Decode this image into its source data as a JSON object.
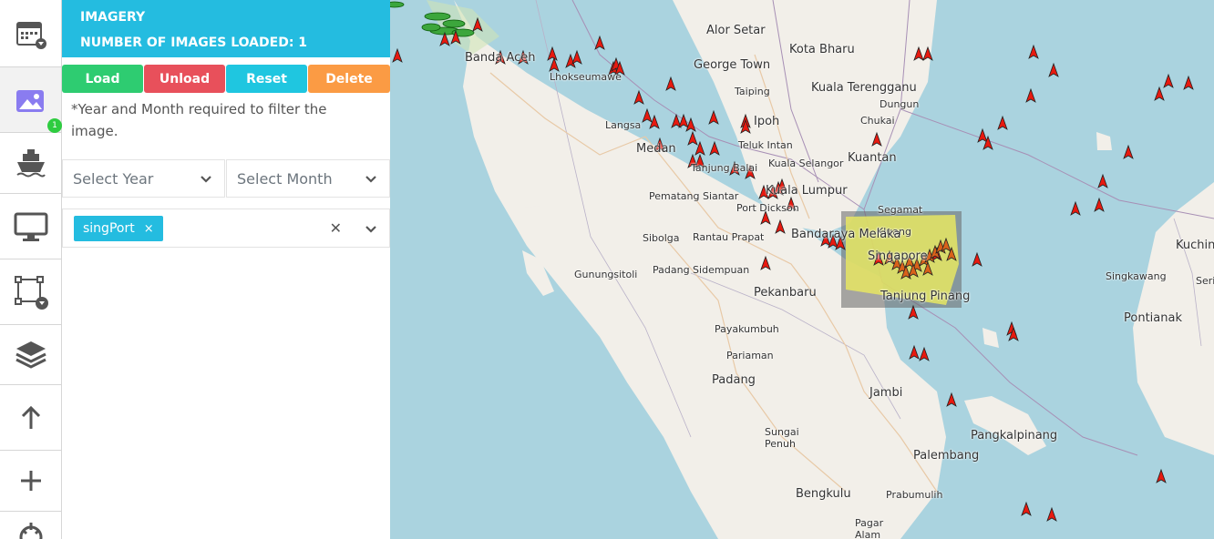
{
  "panel": {
    "title": "IMAGERY",
    "images_loaded": "NUMBER OF IMAGES LOADED: 1",
    "buttons": {
      "load": "Load",
      "unload": "Unload",
      "reset": "Reset",
      "delete": "Delete"
    },
    "note": "*Year and Month required to filter the image.",
    "year_placeholder": "Select Year",
    "month_placeholder": "Select Month",
    "tag": "singPort",
    "tag_remove": "×",
    "clear": "✕"
  },
  "rail": {
    "badge": "1"
  },
  "colors": {
    "header": "#24bce0",
    "load": "#2ecc71",
    "unload": "#e8505b",
    "reset": "#1fc6e0",
    "delete": "#fb9b44",
    "vessel": "#e8190f",
    "image_overlay": "#e6e663"
  },
  "map": {
    "places": [
      {
        "name": "Banda Aceh",
        "cls": "big"
      },
      {
        "name": "Lhokseumawe",
        "cls": "sm"
      },
      {
        "name": "Alor Setar",
        "cls": "big"
      },
      {
        "name": "Kota Bharu",
        "cls": "big"
      },
      {
        "name": "George Town",
        "cls": "big"
      },
      {
        "name": "Kuala Terengganu",
        "cls": "big"
      },
      {
        "name": "Taiping",
        "cls": "sm"
      },
      {
        "name": "Dungun",
        "cls": "sm"
      },
      {
        "name": "Ipoh",
        "cls": "big"
      },
      {
        "name": "Chukai",
        "cls": "sm"
      },
      {
        "name": "Langsa",
        "cls": "sm"
      },
      {
        "name": "Medan",
        "cls": "big"
      },
      {
        "name": "Teluk Intan",
        "cls": "sm"
      },
      {
        "name": "Kuantan",
        "cls": "big"
      },
      {
        "name": "Tanjung Balai",
        "cls": "sm"
      },
      {
        "name": "Kuala Selangor",
        "cls": "sm"
      },
      {
        "name": "Kuala Lumpur",
        "cls": "big"
      },
      {
        "name": "Pematang Siantar",
        "cls": "sm"
      },
      {
        "name": "Port Dickson",
        "cls": "sm"
      },
      {
        "name": "Segamat",
        "cls": "sm"
      },
      {
        "name": "Kluang",
        "cls": "sm"
      },
      {
        "name": "Sibolga",
        "cls": "sm"
      },
      {
        "name": "Rantau Prapat",
        "cls": "sm"
      },
      {
        "name": "Bandaraya Melaka",
        "cls": "big"
      },
      {
        "name": "Gunungsitoli",
        "cls": "sm"
      },
      {
        "name": "Padang Sidempuan",
        "cls": "sm"
      },
      {
        "name": "Pekanbaru",
        "cls": "big"
      },
      {
        "name": "Singapore",
        "cls": "big"
      },
      {
        "name": "Tanjung Pinang",
        "cls": "big"
      },
      {
        "name": "Singkawang",
        "cls": "sm"
      },
      {
        "name": "Pontianak",
        "cls": "big"
      },
      {
        "name": "Kuching",
        "cls": "big"
      },
      {
        "name": "Payakumbuh",
        "cls": "sm"
      },
      {
        "name": "Pariaman",
        "cls": "sm"
      },
      {
        "name": "Padang",
        "cls": "big"
      },
      {
        "name": "Jambi",
        "cls": "big"
      },
      {
        "name": "Sungai Penuh",
        "cls": "sm"
      },
      {
        "name": "Pangkalpinang",
        "cls": "big"
      },
      {
        "name": "Palembang",
        "cls": "big"
      },
      {
        "name": "Bengkulu",
        "cls": "big"
      },
      {
        "name": "Prabumulih",
        "cls": "sm"
      },
      {
        "name": "Pagar Alam",
        "cls": "sm"
      },
      {
        "name": "Seri",
        "cls": "sm"
      }
    ]
  }
}
